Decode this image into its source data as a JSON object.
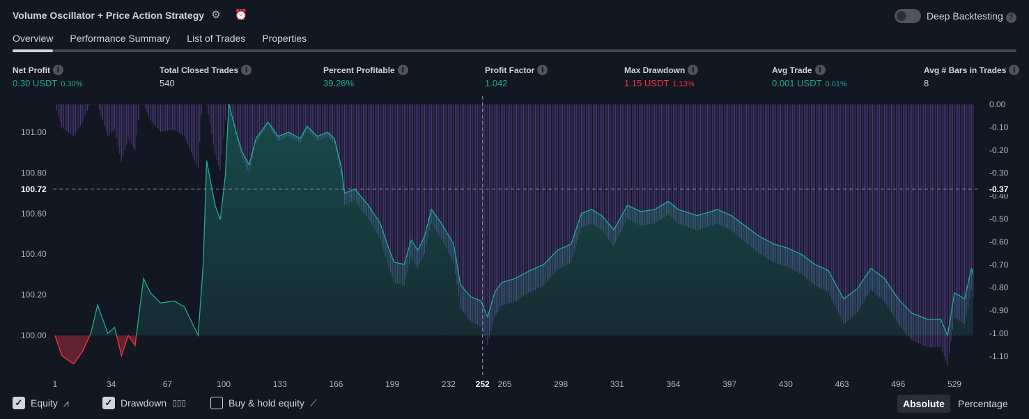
{
  "header": {
    "title": "Volume Oscillator + Price Action Strategy",
    "deep_backtesting": "Deep Backtesting",
    "deep_backtesting_on": false
  },
  "tabs": [
    "Overview",
    "Performance Summary",
    "List of Trades",
    "Properties"
  ],
  "active_tab": "Overview",
  "metrics": [
    {
      "label": "Net Profit",
      "value": "0.30 USDT",
      "pct": "0.30%",
      "color": "green"
    },
    {
      "label": "Total Closed Trades",
      "value": "540",
      "pct": "",
      "color": "white"
    },
    {
      "label": "Percent Profitable",
      "value": "39.26%",
      "pct": "",
      "color": "green"
    },
    {
      "label": "Profit Factor",
      "value": "1.042",
      "pct": "",
      "color": "green"
    },
    {
      "label": "Max Drawdown",
      "value": "1.15 USDT",
      "pct": "1.13%",
      "color": "red"
    },
    {
      "label": "Avg Trade",
      "value": "0.001 USDT",
      "pct": "0.01%",
      "color": "green"
    },
    {
      "label": "Avg # Bars in Trades",
      "value": "8",
      "pct": "",
      "color": "white"
    }
  ],
  "legend": {
    "equity": "Equity",
    "drawdown": "Drawdown",
    "buy_hold": "Buy & hold equity",
    "equity_checked": true,
    "drawdown_checked": true,
    "buy_hold_checked": false
  },
  "scale": {
    "absolute": "Absolute",
    "percentage": "Percentage",
    "selected": "Absolute"
  },
  "colors": {
    "equity_line": "#22ab94",
    "equity_negative": "#f23645",
    "drawdown_bar": "#7e57c2",
    "background": "#131722"
  },
  "chart_data": {
    "type": "area",
    "x_ticks": [
      1,
      34,
      67,
      100,
      133,
      166,
      199,
      232,
      265,
      298,
      331,
      364,
      397,
      430,
      463,
      496,
      529
    ],
    "left_ticks": [
      "100.00",
      "100.20",
      "100.40",
      "100.60",
      "100.80",
      "101.00"
    ],
    "right_ticks": [
      "0.00",
      "-0.10",
      "-0.20",
      "-0.30",
      "-0.40",
      "-0.50",
      "-0.60",
      "-0.70",
      "-0.80",
      "-0.90",
      "-1.00",
      "-1.10"
    ],
    "xlim": [
      1,
      540
    ],
    "left_ylim": [
      99.8,
      101.18
    ],
    "right_ylim": [
      -1.15,
      0
    ],
    "crosshair": {
      "trade": "252",
      "equity": "100.72",
      "drawdown": "-0.37"
    },
    "equity": {
      "trade": [
        1,
        5,
        12,
        17,
        22,
        26,
        32,
        36,
        40,
        44,
        48,
        53,
        57,
        63,
        71,
        77,
        85,
        88,
        90,
        95,
        98,
        101,
        103,
        108,
        111,
        115,
        119,
        126,
        132,
        138,
        145,
        149,
        155,
        161,
        165,
        169,
        171,
        177,
        185,
        192,
        196,
        200,
        206,
        210,
        214,
        218,
        222,
        228,
        235,
        239,
        245,
        251,
        255,
        259,
        263,
        271,
        280,
        288,
        296,
        304,
        310,
        316,
        322,
        329,
        337,
        345,
        353,
        361,
        367,
        378,
        390,
        398,
        406,
        414,
        423,
        431,
        439,
        447,
        455,
        464,
        472,
        480,
        488,
        496,
        504,
        513,
        521,
        525,
        529,
        535,
        539,
        540
      ],
      "value": [
        100.0,
        99.9,
        99.86,
        99.92,
        100.01,
        100.15,
        100.01,
        100.04,
        99.9,
        100.0,
        99.95,
        100.28,
        100.21,
        100.16,
        100.17,
        100.14,
        100.0,
        100.35,
        100.86,
        100.64,
        100.57,
        100.79,
        101.14,
        100.98,
        100.9,
        100.84,
        100.97,
        101.05,
        100.98,
        101.0,
        100.97,
        101.03,
        100.98,
        101.0,
        100.97,
        100.83,
        100.7,
        100.72,
        100.64,
        100.55,
        100.45,
        100.36,
        100.35,
        100.47,
        100.42,
        100.49,
        100.62,
        100.55,
        100.45,
        100.25,
        100.19,
        100.17,
        100.09,
        100.21,
        100.26,
        100.28,
        100.32,
        100.35,
        100.42,
        100.45,
        100.6,
        100.62,
        100.59,
        100.52,
        100.64,
        100.61,
        100.62,
        100.66,
        100.62,
        100.59,
        100.62,
        100.59,
        100.54,
        100.49,
        100.45,
        100.43,
        100.4,
        100.35,
        100.32,
        100.18,
        100.23,
        100.33,
        100.28,
        100.18,
        100.11,
        100.08,
        100.08,
        100.0,
        100.21,
        100.18,
        100.33,
        100.3
      ]
    }
  }
}
